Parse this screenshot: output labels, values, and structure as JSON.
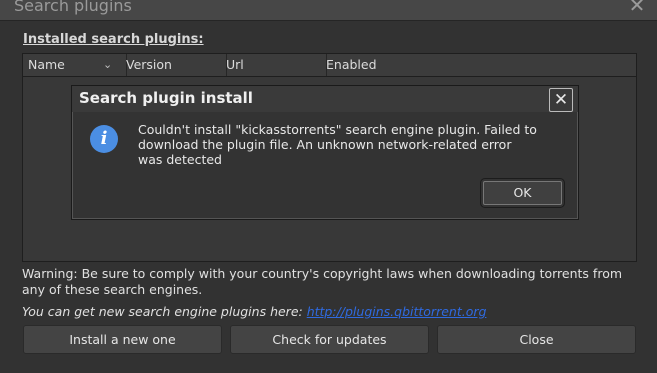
{
  "window": {
    "title": "Search plugins"
  },
  "installed_label": "Installed search plugins:",
  "table": {
    "columns": [
      "Name",
      "Version",
      "Url",
      "Enabled"
    ]
  },
  "warning": "Warning: Be sure to comply with your country's copyright laws when downloading torrents from any of these search engines.",
  "get_plugins": {
    "text": "You can get new search engine plugins here: ",
    "link": "http://plugins.qbittorrent.org"
  },
  "buttons": {
    "install": "Install a new one",
    "check": "Check for updates",
    "close": "Close"
  },
  "dialog": {
    "title": "Search plugin install",
    "message": "Couldn't install \"kickasstorrents\" search engine plugin. Failed to download the plugin file. An unknown network-related error was detected",
    "ok": "OK",
    "icon": "info-icon"
  },
  "colors": {
    "link": "#2f6ae0",
    "info_icon": "#4b8ee3"
  }
}
